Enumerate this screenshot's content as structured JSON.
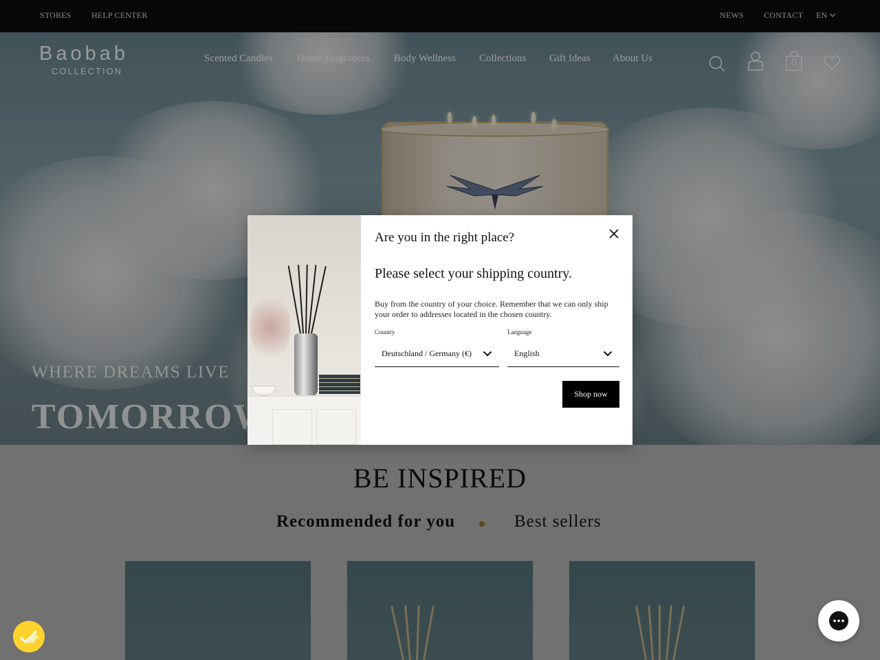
{
  "topbar": {
    "stores": "STORES",
    "help_center": "HELP CENTER",
    "news": "NEWS",
    "contact": "CONTACT",
    "language": "EN"
  },
  "header": {
    "logo_main": "Baobab",
    "logo_sub": "COLLECTION",
    "nav": [
      "Scented Candles",
      "Home Fragrances",
      "Body Wellness",
      "Collections",
      "Gift Ideas",
      "About Us"
    ],
    "cart_count": "0",
    "icons": [
      "search-icon",
      "account-icon",
      "bag-icon",
      "heart-icon"
    ]
  },
  "hero": {
    "tagline": "WHERE DREAMS LIVE",
    "title": "TOMORROW"
  },
  "inspired": {
    "title": "BE INSPIRED",
    "tabs": [
      "Recommended for you",
      "Best sellers"
    ]
  },
  "modal": {
    "title": "Are you in the right place?",
    "subtitle": "Please select your shipping country.",
    "description": "Buy from the country of your choice. Remember that we can only ship your order to addresses located in the chosen country.",
    "country_label": "Country",
    "country_value": "Deutschland / Germany (€)",
    "language_label": "Language",
    "language_value": "English",
    "shop_button": "Shop now"
  },
  "colors": {
    "topbar": "#0b0b0b",
    "button": "#000000",
    "accent_dot": "#8a6e2a",
    "cookie_widget": "#ffd32e"
  }
}
